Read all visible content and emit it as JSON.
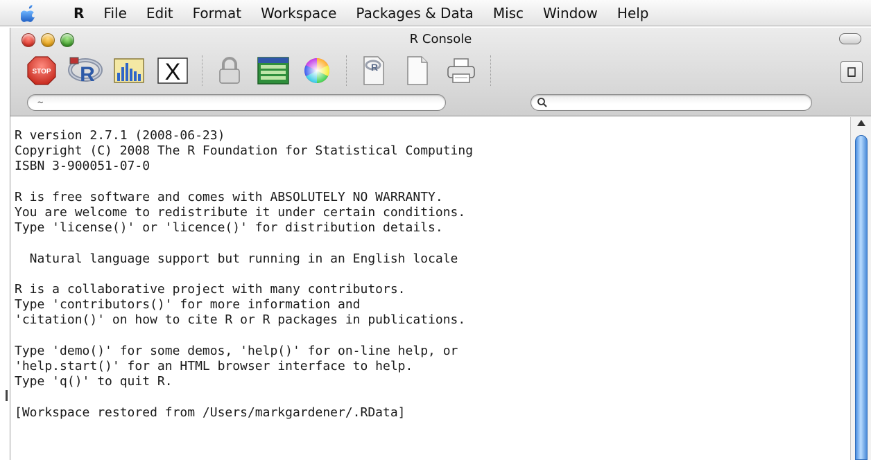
{
  "menubar": {
    "apple_icon": "apple-logo",
    "items": [
      "R",
      "File",
      "Edit",
      "Format",
      "Workspace",
      "Packages & Data",
      "Misc",
      "Window",
      "Help"
    ]
  },
  "window": {
    "title": "R Console",
    "toolbar": [
      {
        "name": "stop",
        "label": "STOP",
        "icon": "stop-sign-icon"
      },
      {
        "name": "source-script",
        "icon": "r-logo-icon"
      },
      {
        "name": "quartz",
        "icon": "bar-chart-icon"
      },
      {
        "name": "x11",
        "label": "X",
        "icon": "x11-icon"
      },
      {
        "name": "authorize",
        "icon": "lock-icon"
      },
      {
        "name": "data-editor",
        "icon": "spreadsheet-icon"
      },
      {
        "name": "colors",
        "icon": "color-wheel-icon"
      },
      {
        "name": "open-script",
        "icon": "r-document-icon"
      },
      {
        "name": "new-document",
        "icon": "blank-document-icon"
      },
      {
        "name": "print",
        "icon": "printer-icon"
      }
    ],
    "working_dir_value": "~",
    "search_placeholder": ""
  },
  "console": {
    "lines": [
      "R version 2.7.1 (2008-06-23)",
      "Copyright (C) 2008 The R Foundation for Statistical Computing",
      "ISBN 3-900051-07-0",
      "",
      "R is free software and comes with ABSOLUTELY NO WARRANTY.",
      "You are welcome to redistribute it under certain conditions.",
      "Type 'license()' or 'licence()' for distribution details.",
      "",
      "  Natural language support but running in an English locale",
      "",
      "R is a collaborative project with many contributors.",
      "Type 'contributors()' for more information and",
      "'citation()' on how to cite R or R packages in publications.",
      "",
      "Type 'demo()' for some demos, 'help()' for on-line help, or",
      "'help.start()' for an HTML browser interface to help.",
      "Type 'q()' to quit R.",
      "",
      "[Workspace restored from /Users/markgardener/.RData]"
    ]
  },
  "colors": {
    "accent_blue": "#4b8fe2",
    "close": "#d9362a",
    "minimize": "#e09d14",
    "zoom": "#3f9b2c"
  }
}
